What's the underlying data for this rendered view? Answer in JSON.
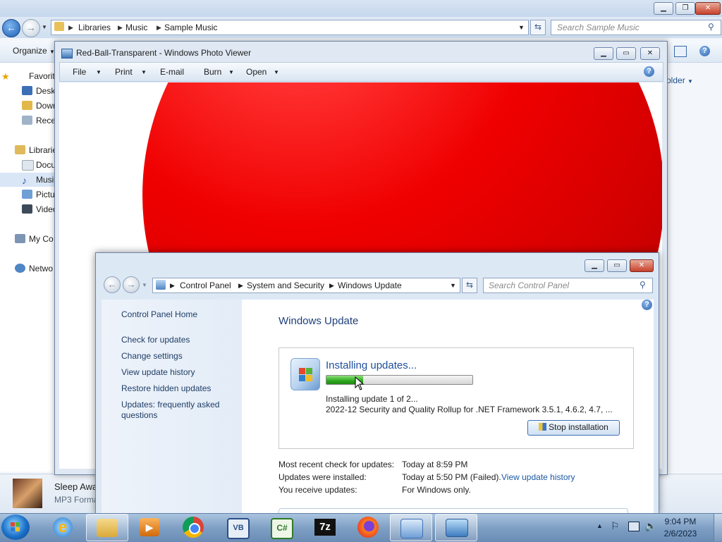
{
  "explorer": {
    "breadcrumb": [
      "Libraries",
      "Music",
      "Sample Music"
    ],
    "search_placeholder": "Search Sample Music",
    "organize_label": "Organize",
    "folder_hint": "older",
    "sidebar": {
      "favorites": "Favorit",
      "desktop": "Desk",
      "downloads": "Dowr",
      "recent": "Rece",
      "libraries": "Librarie",
      "documents": "Docu",
      "music": "Musi",
      "pictures": "Pictu",
      "videos": "Video",
      "my_computer": "My Co",
      "network": "Netwo"
    },
    "details": {
      "name": "Sleep Awa",
      "type": "MP3 Forma"
    }
  },
  "photo_viewer": {
    "title": "Red-Ball-Transparent - Windows Photo Viewer",
    "menu": {
      "file": "File",
      "print": "Print",
      "email": "E-mail",
      "burn": "Burn",
      "open": "Open"
    }
  },
  "control_panel": {
    "breadcrumb": [
      "Control Panel",
      "System and Security",
      "Windows Update"
    ],
    "search_placeholder": "Search Control Panel",
    "left_links": {
      "home": "Control Panel Home",
      "check": "Check for updates",
      "change": "Change settings",
      "history": "View update history",
      "restore": "Restore hidden updates",
      "faq": "Updates: frequently asked questions"
    },
    "heading": "Windows Update",
    "status": {
      "title": "Installing updates...",
      "progress_fraction": 0.25,
      "line1": "Installing update 1 of 2...",
      "line2": "2022-12 Security and Quality Rollup for .NET Framework 3.5.1, 4.6.2, 4.7, ...",
      "stop_button": "Stop installation"
    },
    "info": {
      "recent_check_label": "Most recent check for updates:",
      "recent_check_value": "Today at 8:59 PM",
      "installed_label": "Updates were installed:",
      "installed_value": "Today at 5:50 PM (Failed).",
      "installed_link": "View update history",
      "receive_label": "You receive updates:",
      "receive_value": "For Windows only."
    }
  },
  "taskbar": {
    "apps": [
      "internet-explorer",
      "file-explorer",
      "media-player",
      "chrome",
      "visual-basic",
      "csharp",
      "7zip",
      "firefox",
      "control-panel",
      "photo-viewer"
    ],
    "time": "9:04 PM",
    "date": "2/6/2023"
  },
  "colors": {
    "accent": "#1e4f9c",
    "link": "#1c5aa6",
    "progress": "#2ea81f",
    "ball": "#f00000"
  }
}
